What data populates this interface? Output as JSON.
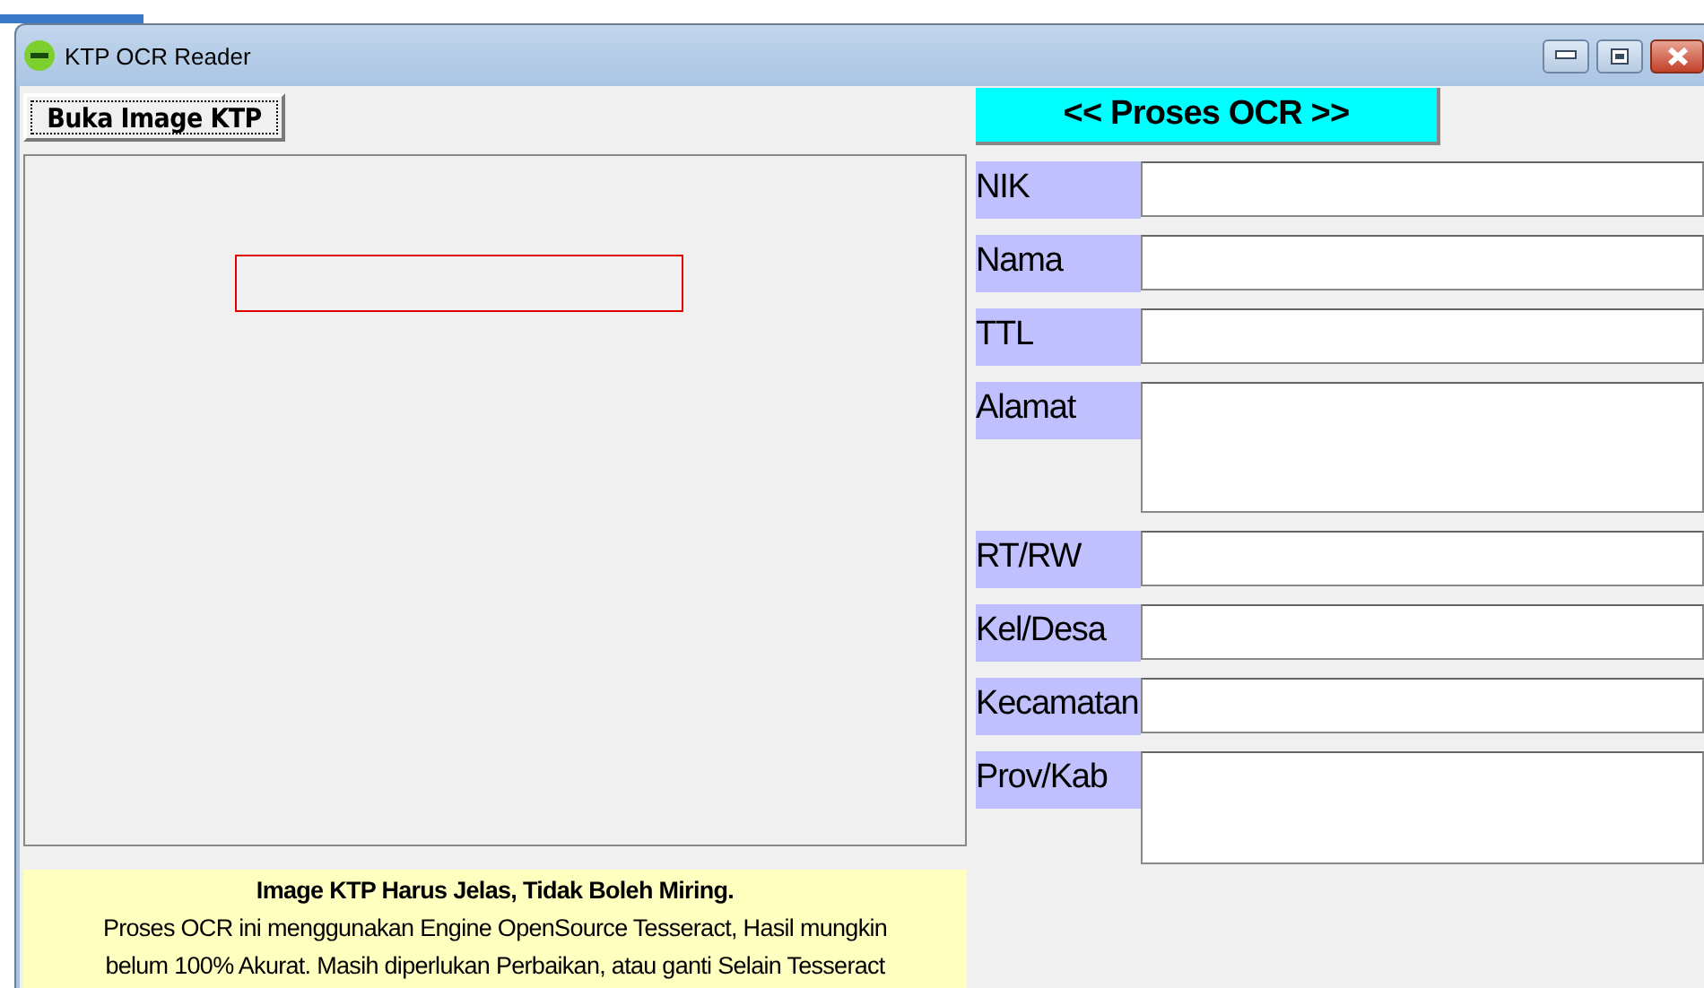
{
  "window": {
    "title": "KTP OCR Reader"
  },
  "open_button": {
    "label": "Buka Image KTP"
  },
  "ocr_button": {
    "label": "<< Proses OCR >>"
  },
  "fields": [
    {
      "label": "NIK",
      "kind": "line"
    },
    {
      "label": "Nama",
      "kind": "line"
    },
    {
      "label": "TTL",
      "kind": "line"
    },
    {
      "label": "Alamat",
      "kind": "area"
    },
    {
      "label": "RT/RW",
      "kind": "line"
    },
    {
      "label": "Kel/Desa",
      "kind": "line"
    },
    {
      "label": "Kecamatan",
      "kind": "line"
    },
    {
      "label": "Prov/Kab",
      "kind": "box"
    }
  ],
  "note": {
    "heading": "Image KTP Harus Jelas, Tidak Boleh Miring.",
    "lines": [
      "Proses OCR ini menggunakan Engine OpenSource Tesseract, Hasil mungkin",
      "belum 100% Akurat. Masih diperlukan Perbaikan, atau ganti Selain Tesseract"
    ]
  }
}
